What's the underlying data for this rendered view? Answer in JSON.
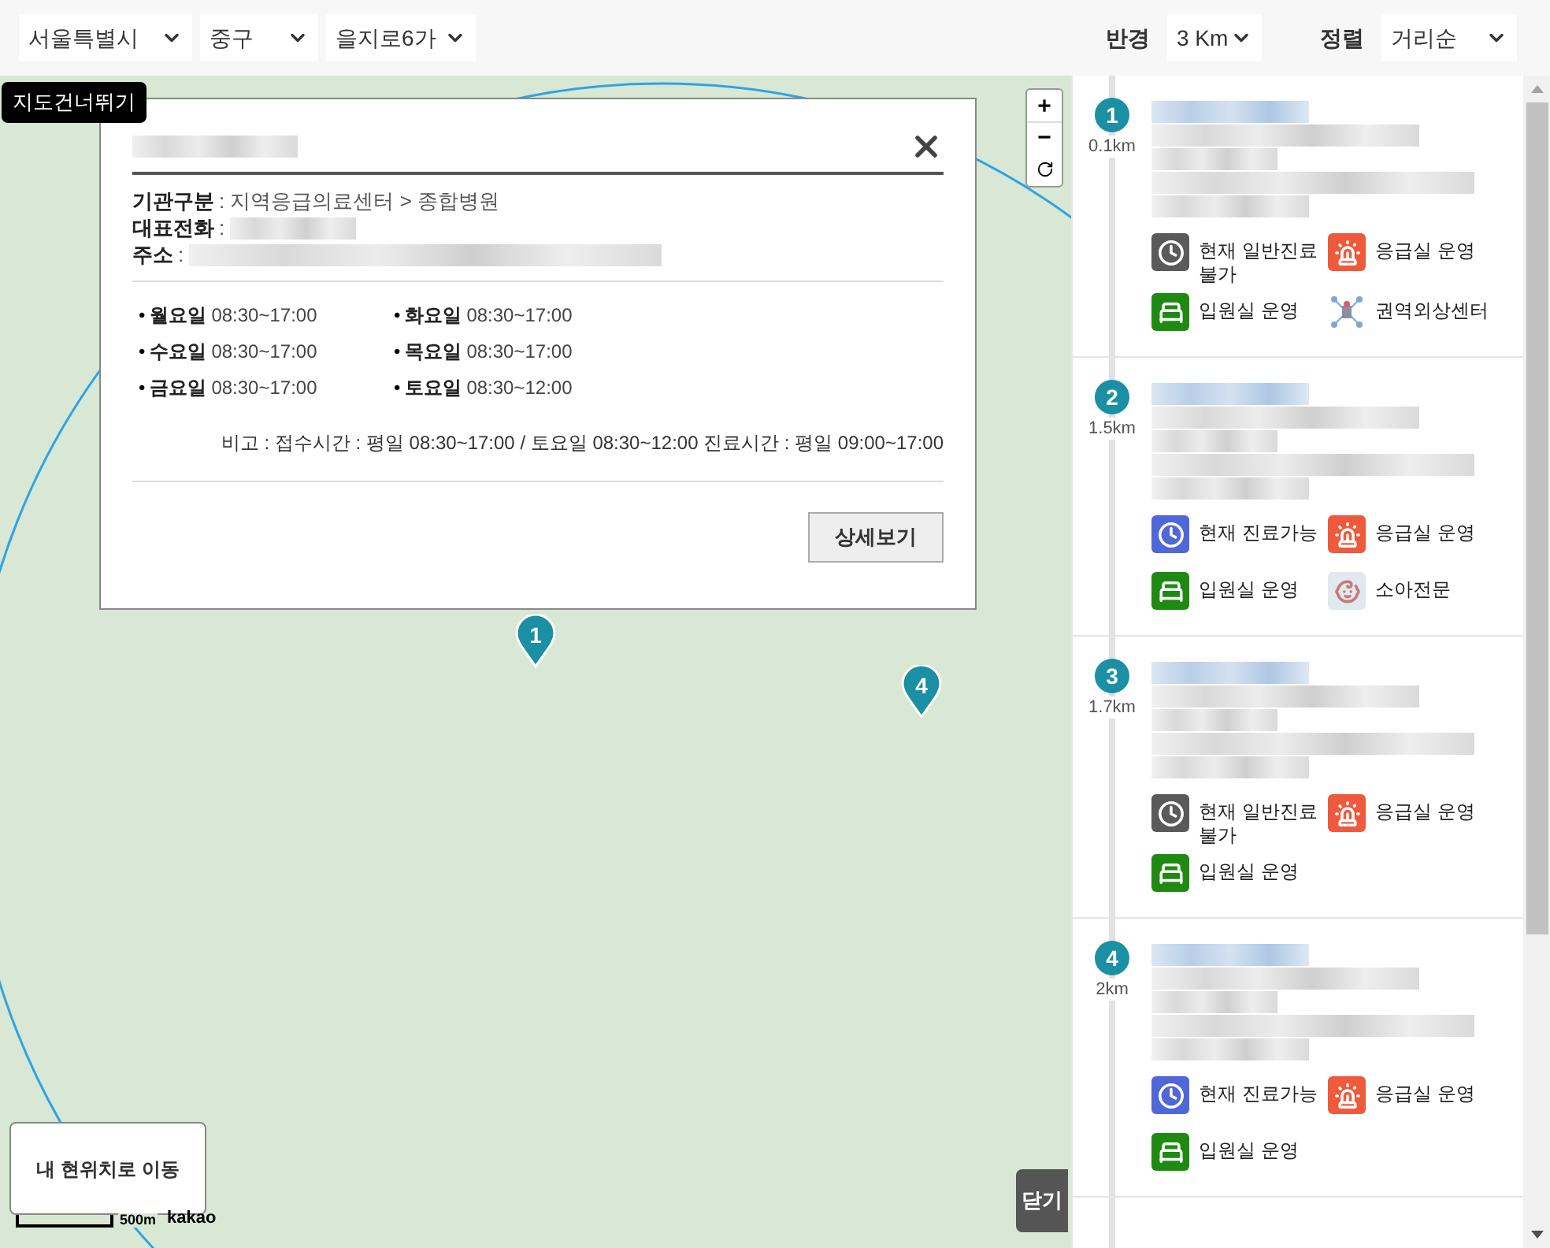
{
  "filters": {
    "regions": [
      {
        "value": "서울특별시"
      },
      {
        "value": "중구"
      },
      {
        "value": "을지로6가"
      }
    ],
    "radius": {
      "label": "반경",
      "value": "3 Km"
    },
    "sort": {
      "label": "정렬",
      "value": "거리순"
    }
  },
  "map": {
    "skip_button": "지도건너뛰기",
    "zoom_in": "+",
    "zoom_out": "−",
    "markers": [
      {
        "number": "1"
      },
      {
        "number": "4"
      }
    ],
    "my_location_button": "내 현위치로 이동",
    "scale": "500m",
    "logo": "kakao",
    "close_button": "닫기"
  },
  "popup": {
    "info": [
      {
        "label": "기관구분",
        "value": ": 지역응급의료센터 > 종합병원",
        "redacted": false
      },
      {
        "label": "대표전화",
        "value": ":",
        "redacted": true
      },
      {
        "label": "주소",
        "value": ":",
        "redacted": true
      }
    ],
    "hours": [
      {
        "bullet": "•",
        "day": "월요일",
        "time": "08:30~17:00"
      },
      {
        "bullet": "•",
        "day": "화요일",
        "time": "08:30~17:00"
      },
      {
        "bullet": "•",
        "day": "수요일",
        "time": "08:30~17:00"
      },
      {
        "bullet": "•",
        "day": "목요일",
        "time": "08:30~17:00"
      },
      {
        "bullet": "•",
        "day": "금요일",
        "time": "08:30~17:00"
      },
      {
        "bullet": "•",
        "day": "토요일",
        "time": "08:30~12:00"
      }
    ],
    "note": "비고 : 접수시간 : 평일 08:30~17:00 / 토요일 08:30~12:00 진료시간 : 평일 09:00~17:00",
    "detail_button": "상세보기"
  },
  "hospitals": [
    {
      "number": "1",
      "distance": "0.1km",
      "badges": [
        {
          "kind": "hours",
          "label": "현재 일반진료불가",
          "on": false
        },
        {
          "kind": "emergency",
          "label": "응급실 운영",
          "on": true
        },
        {
          "kind": "ward",
          "label": "입원실 운영",
          "on": true
        },
        {
          "kind": "trauma",
          "label": "권역외상센터",
          "on": true
        }
      ]
    },
    {
      "number": "2",
      "distance": "1.5km",
      "badges": [
        {
          "kind": "hours",
          "label": "현재 진료가능",
          "on": true
        },
        {
          "kind": "emergency",
          "label": "응급실 운영",
          "on": true
        },
        {
          "kind": "ward",
          "label": "입원실 운영",
          "on": true
        },
        {
          "kind": "pediatric",
          "label": "소아전문",
          "on": true
        }
      ]
    },
    {
      "number": "3",
      "distance": "1.7km",
      "badges": [
        {
          "kind": "hours",
          "label": "현재 일반진료불가",
          "on": false
        },
        {
          "kind": "emergency",
          "label": "응급실 운영",
          "on": true
        },
        {
          "kind": "ward",
          "label": "입원실 운영",
          "on": true
        }
      ]
    },
    {
      "number": "4",
      "distance": "2km",
      "badges": [
        {
          "kind": "hours",
          "label": "현재 진료가능",
          "on": true
        },
        {
          "kind": "emergency",
          "label": "응급실 운영",
          "on": true
        },
        {
          "kind": "ward",
          "label": "입원실 운영",
          "on": true
        }
      ]
    }
  ]
}
